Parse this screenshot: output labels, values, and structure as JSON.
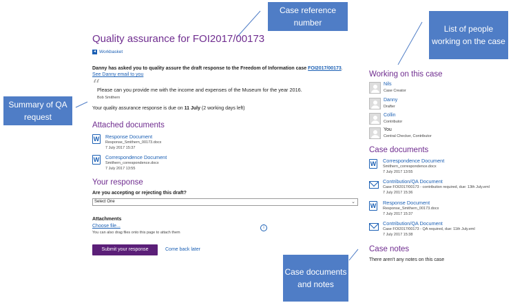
{
  "page": {
    "title": "Quality assurance for FOI2017/00173",
    "workbasket_label": "Workbasket",
    "request_prefix": "Danny has asked you to quality assure the draft response to the Freedom of Information case",
    "case_link": "FOI2017/00173",
    "request_suffix": ".",
    "see_prefix": "See ",
    "email_link": "Danny email",
    "to_you": " to you",
    "quote_text": "Please can you provide me with the income and expenses of the Museum for the year 2016.",
    "quote_author": "Bob Smithern",
    "due_prefix": "Your quality assurance response is due on ",
    "due_date": "11 July",
    "due_suffix": " (2 working days left)"
  },
  "attached": {
    "heading": "Attached documents",
    "docs": [
      {
        "title": "Response Document",
        "file": "Response_Smithern_00173.docx",
        "date": "7 July 2017 15:37"
      },
      {
        "title": "Correspondence Document",
        "file": "Smithern_correspondence.docx",
        "date": "7 July 2017 13:55"
      }
    ]
  },
  "response": {
    "heading": "Your response",
    "question": "Are you accepting or rejecting this draft?",
    "select_value": "Select One",
    "attachments_label": "Attachments",
    "choose_file": "Choose file...",
    "drag_hint": "You can also drag files onto this page to attach them",
    "info_glyph": "i",
    "submit": "Submit your response",
    "come_back": "Come back later"
  },
  "sidebar": {
    "working_heading": "Working on this case",
    "people": [
      {
        "name": "Nils",
        "role": "Case Creator"
      },
      {
        "name": "Danny",
        "role": "Drafter"
      },
      {
        "name": "Collin",
        "role": "Contributor"
      },
      {
        "name": "You",
        "role": "Central Checker, Contributor"
      }
    ],
    "docs_heading": "Case documents",
    "docs": [
      {
        "icon": "word-doc-icon",
        "title": "Correspondence Document",
        "line1": "Smithern_correspondence.docx",
        "line2": "7 July 2017 13:55"
      },
      {
        "icon": "email-icon",
        "title": "Contribution/QA Document",
        "line1": "Case FOI2017/00173 - contribution required, due: 13th July.eml",
        "line2": "7 July 2017 15:36"
      },
      {
        "icon": "word-doc-icon",
        "title": "Response Document",
        "line1": "Response_Smithern_00173.docx",
        "line2": "7 July 2017 15:37"
      },
      {
        "icon": "email-icon",
        "title": "Contribution/QA Document",
        "line1": "Case FOI2017/00173 - QA required, due: 11th July.eml",
        "line2": "7 July 2017 15:38"
      }
    ],
    "notes_heading": "Case notes",
    "notes_empty": "There aren't any notes on this case"
  },
  "callouts": {
    "case_ref": "Case reference number",
    "people": "List of people working on the case",
    "summary": "Summary of QA request",
    "docs_notes": "Case documents and notes"
  },
  "colors": {
    "accent": "#6f2c8f",
    "link": "#1a5fb4",
    "callout": "#4f7dc6",
    "button": "#5b1f78"
  }
}
